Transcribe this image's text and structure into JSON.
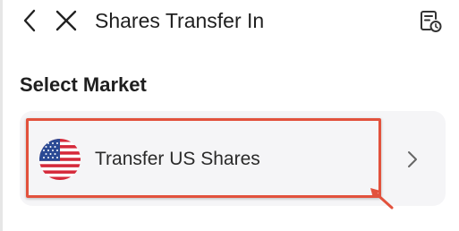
{
  "header": {
    "title": "Shares Transfer In",
    "back_icon": "back-arrow-icon",
    "close_icon": "close-icon",
    "history_icon": "records-history-icon"
  },
  "section": {
    "title": "Select Market"
  },
  "market_options": [
    {
      "label": "Transfer US Shares",
      "icon": "us-flag-icon",
      "action_icon": "chevron-right-icon"
    }
  ],
  "colors": {
    "highlight": "#e2523d",
    "card_background": "#f5f5f7",
    "text": "#1f1f1f"
  }
}
